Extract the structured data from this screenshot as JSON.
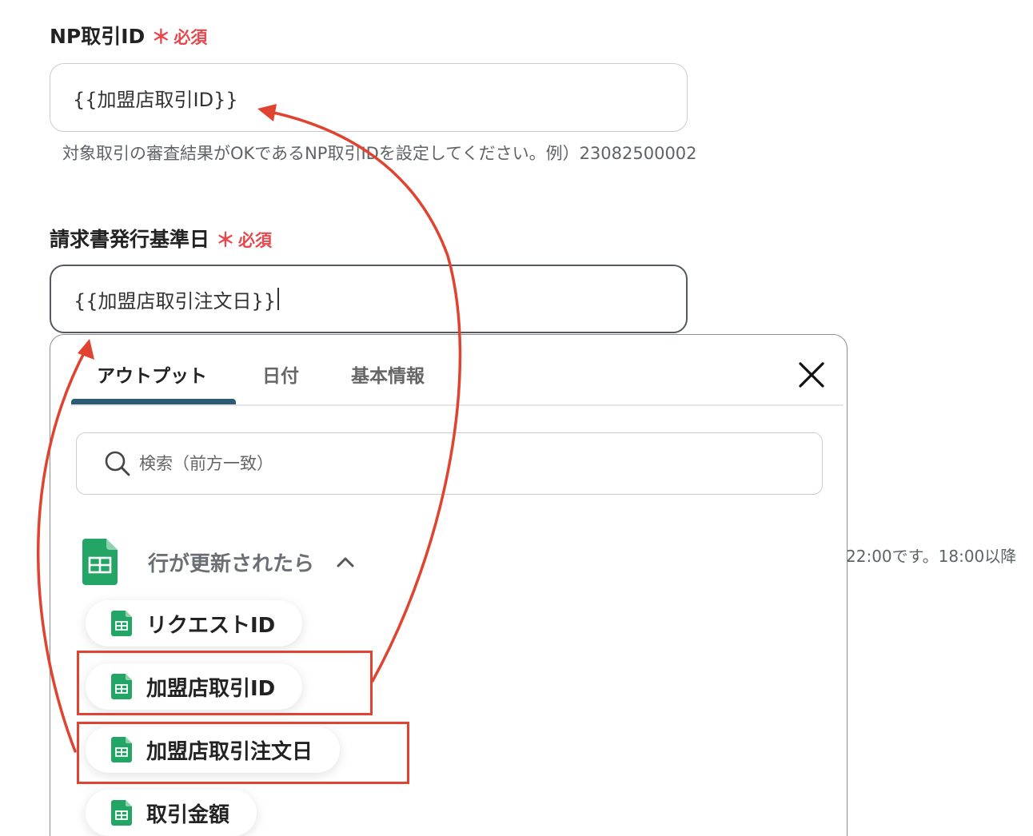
{
  "fields": [
    {
      "label": "NP取引ID",
      "required_label": "必須",
      "value": "{{加盟店取引ID}}",
      "hint": "対象取引の審査結果がOKであるNP取引IDを設定してください。例）23082500002"
    },
    {
      "label": "請求書発行基準日",
      "required_label": "必須",
      "value": "{{加盟店取引注文日}}"
    }
  ],
  "side_text": "22:00です。18:00以降",
  "panel": {
    "tabs": [
      {
        "label": "アウトプット",
        "selected": true
      },
      {
        "label": "日付",
        "selected": false
      },
      {
        "label": "基本情報",
        "selected": false
      }
    ],
    "search_placeholder": "検索（前方一致）",
    "group": {
      "title": "行が更新されたら",
      "icon": "google-sheets-icon",
      "items": [
        {
          "label": "リクエストID",
          "highlighted": false
        },
        {
          "label": "加盟店取引ID",
          "highlighted": true
        },
        {
          "label": "加盟店取引注文日",
          "highlighted": true
        },
        {
          "label": "取引金額",
          "highlighted": false
        }
      ]
    }
  },
  "colors": {
    "required": "#e5484d",
    "tab_underline": "#2b5a73",
    "annotation": "#e0432f",
    "sheets_green": "#23a566"
  }
}
